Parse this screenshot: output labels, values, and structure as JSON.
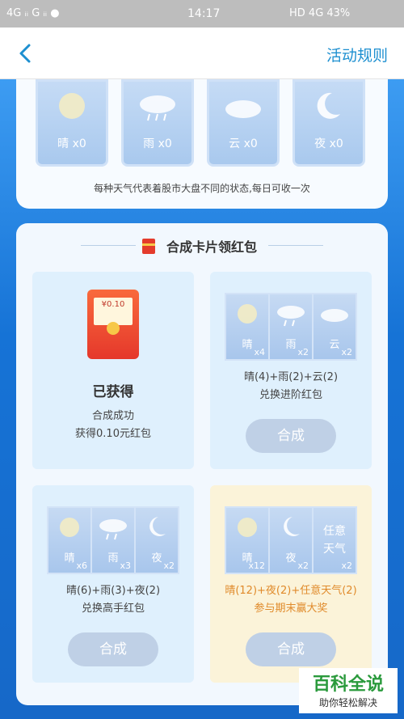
{
  "status_bar": {
    "left": "4G ᵢᵢ G ᵢᵢ ●",
    "time": "14:17",
    "right": "HD 4G 43%"
  },
  "nav": {
    "rules_label": "活动规则"
  },
  "weather_tiles": [
    {
      "label": "晴 x0",
      "icon": "sun-icon"
    },
    {
      "label": "雨 x0",
      "icon": "rain-cloud-icon"
    },
    {
      "label": "云 x0",
      "icon": "cloud-icon"
    },
    {
      "label": "夜 x0",
      "icon": "moon-icon"
    }
  ],
  "top_hint": "每种天气代表着股市大盘不同的状态,每日可收一次",
  "section_title": "合成卡片领红包",
  "panels": {
    "p1": {
      "envelope_amount": "¥0.10",
      "status": "已获得",
      "line1": "合成成功",
      "line2": "获得0.10元红包"
    },
    "p2": {
      "cards": [
        {
          "label": "晴",
          "count": "x4"
        },
        {
          "label": "雨",
          "count": "x2"
        },
        {
          "label": "云",
          "count": "x2"
        }
      ],
      "formula": "晴(4)+雨(2)+云(2)",
      "reward": "兑换进阶红包",
      "button": "合成"
    },
    "p3": {
      "cards": [
        {
          "label": "晴",
          "count": "x6"
        },
        {
          "label": "雨",
          "count": "x3"
        },
        {
          "label": "夜",
          "count": "x2"
        }
      ],
      "formula": "晴(6)+雨(3)+夜(2)",
      "reward": "兑换高手红包",
      "button": "合成"
    },
    "p4": {
      "cards": [
        {
          "label": "晴",
          "count": "x12"
        },
        {
          "label": "夜",
          "count": "x2"
        },
        {
          "label": "任意天气",
          "count": "x2"
        }
      ],
      "formula": "晴(12)+夜(2)+任意天气(2)",
      "reward": "参与期末赢大奖",
      "button": "合成"
    }
  },
  "watermark": {
    "title": "百科全说",
    "subtitle": "助你轻松解决"
  },
  "colors": {
    "accent": "#1d8fd0",
    "brand_blue": "#1f78d8",
    "gold_text": "#e08a2a"
  }
}
